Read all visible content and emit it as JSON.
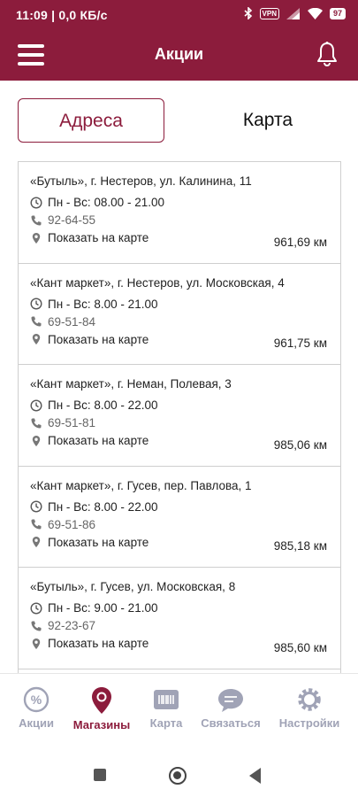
{
  "status_bar": {
    "time_info": "11:09 | 0,0 КБ/с",
    "vpn": "VPN",
    "battery": "97"
  },
  "header": {
    "title": "Акции"
  },
  "segments": {
    "addresses": "Адреса",
    "map": "Карта"
  },
  "colors": {
    "brand": "#8c1c3c",
    "nav_inactive": "#a0a3b6"
  },
  "stores": [
    {
      "address": "«Бутыль», г. Нестеров, ул. Калинина, 11",
      "hours": "Пн - Вс: 08.00 - 21.00",
      "phone": "92-64-55",
      "map_link": "Показать на карте",
      "distance": "961,69 км"
    },
    {
      "address": "«Кант маркет», г. Нестеров, ул. Московская, 4",
      "hours": "Пн - Вс: 8.00 - 21.00",
      "phone": "69-51-84",
      "map_link": "Показать на карте",
      "distance": "961,75 км"
    },
    {
      "address": "«Кант маркет», г. Неман, Полевая, 3",
      "hours": "Пн - Вс: 8.00 - 22.00",
      "phone": "69-51-81",
      "map_link": "Показать на карте",
      "distance": "985,06 км"
    },
    {
      "address": "«Кант маркет», г. Гусев, пер. Павлова, 1",
      "hours": "Пн - Вс: 8.00 - 22.00",
      "phone": "69-51-86",
      "map_link": "Показать на карте",
      "distance": "985,18 км"
    },
    {
      "address": "«Бутыль», г. Гусев, ул. Московская, 8",
      "hours": "Пн - Вс: 9.00 - 21.00",
      "phone": "92-23-67",
      "map_link": "Показать на карте",
      "distance": "985,60 км"
    }
  ],
  "bottom_nav": {
    "promos": "Акции",
    "stores": "Магазины",
    "card": "Карта",
    "contact": "Связаться",
    "settings": "Настройки"
  }
}
